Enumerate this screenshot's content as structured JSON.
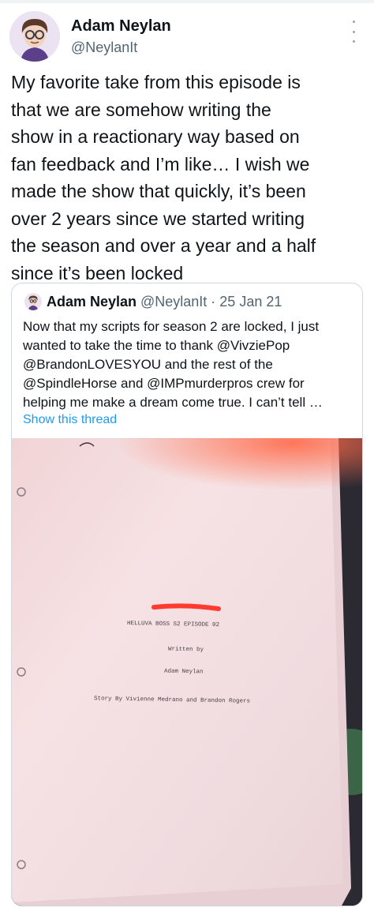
{
  "tweet": {
    "author_name": "Adam Neylan",
    "author_handle": "@NeylanIt",
    "text": "My favorite take from this episode is\nthat we are somehow writing the\nshow in a reactionary way based on\nfan feedback and I’m like… I wish we\nmade the show that quickly, it’s been\nover 2 years since we started writing\nthe season and over a year and a half\nsince it’s been locked"
  },
  "quoted": {
    "author_name": "Adam Neylan",
    "author_handle_date": "@NeylanIt · 25 Jan 21",
    "text": "Now that my scripts for season 2 are locked, I just\nwanted to take the time to thank @VivziePop\n@BrandonLOVESYOU and the rest of the\n@SpindleHorse and @IMPmurderpros crew for\nhelping me make a dream come true. I can’t tell …",
    "show_thread": "Show this thread"
  },
  "script_page": {
    "title": "HELLUVA BOSS S2 EPISODE 02",
    "written_by": "Written by",
    "author": "Adam Neylan",
    "story_by": "Story By Vivienne Medrano and Brandon Rogers"
  },
  "icons": {
    "more": "more-vertical-icon",
    "avatar": "avatar-icon"
  },
  "colors": {
    "text": "#0f1419",
    "secondary": "#536471",
    "link": "#1d9bf0",
    "border": "#cfd9de"
  }
}
